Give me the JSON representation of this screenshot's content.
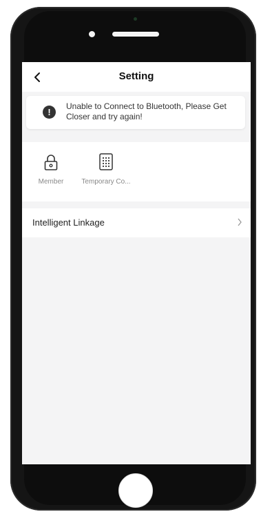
{
  "navbar": {
    "title": "Setting",
    "back_icon": "chevron-left-icon"
  },
  "alert": {
    "icon": "exclamation-icon",
    "message": "Unable to Connect to Bluetooth, Please Get Closer and try again!"
  },
  "features": [
    {
      "label": "Member",
      "icon": "lock-icon"
    },
    {
      "label": "Temporary Co...",
      "icon": "keypad-icon"
    }
  ],
  "linkage": {
    "label": "Intelligent Linkage",
    "chevron": "chevron-right-icon"
  },
  "colors": {
    "screen_bg": "#f4f4f5",
    "card_bg": "#ffffff",
    "phone_body": "#151515"
  }
}
